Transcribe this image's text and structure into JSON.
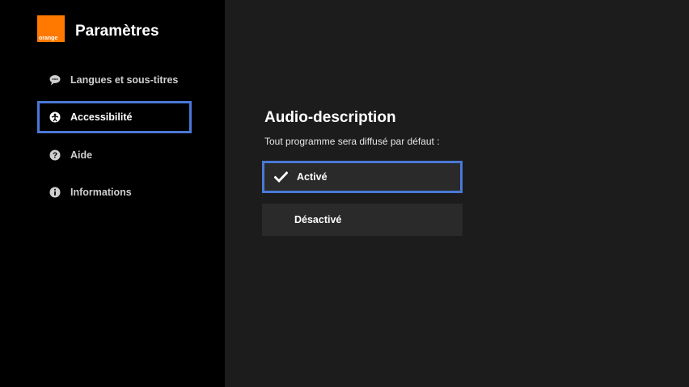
{
  "brand": {
    "logo_text": "orange",
    "accent_color": "#ff7900"
  },
  "sidebar": {
    "title": "Paramètres",
    "items": [
      {
        "label": "Langues et sous-titres",
        "icon": "speech-bubble-icon",
        "selected": false
      },
      {
        "label": "Accessibilité",
        "icon": "accessibility-icon",
        "selected": true
      },
      {
        "label": "Aide",
        "icon": "help-icon",
        "selected": false
      },
      {
        "label": "Informations",
        "icon": "info-icon",
        "selected": false
      }
    ]
  },
  "main": {
    "title": "Audio-description",
    "subtitle": "Tout programme sera diffusé par défaut :",
    "options": [
      {
        "label": "Activé",
        "checked": true,
        "focused": true
      },
      {
        "label": "Désactivé",
        "checked": false,
        "focused": false
      }
    ]
  },
  "colors": {
    "focus_border": "#4a78d6",
    "sidebar_bg": "#000000",
    "main_bg": "#1c1c1c",
    "option_bg": "#2a2a2a"
  }
}
